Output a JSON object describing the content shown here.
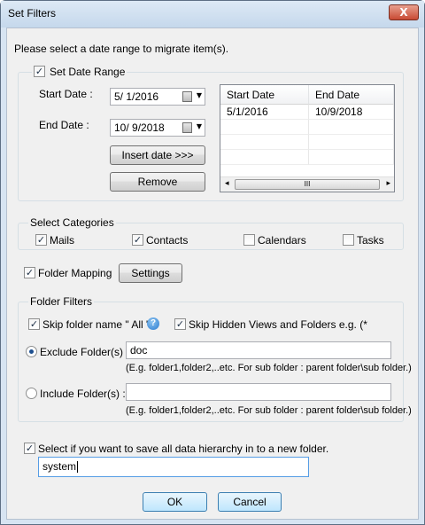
{
  "window": {
    "title": "Set Filters",
    "close_glyph": "X"
  },
  "intro": "Please select a date range to migrate item(s).",
  "date_range": {
    "legend": "Set Date Range",
    "checked": true,
    "start_label": "Start Date :",
    "start_value": "5/  1/2016",
    "end_label": "End Date :",
    "end_value": "10/  9/2018",
    "insert_button": "Insert date >>>",
    "remove_button": "Remove",
    "grid": {
      "columns": [
        "Start Date",
        "End Date"
      ],
      "rows": [
        [
          "5/1/2016",
          "10/9/2018"
        ]
      ],
      "scroll_left": "◂",
      "scroll_thumb": "III",
      "scroll_right": "▸"
    }
  },
  "categories": {
    "legend": "Select Categories",
    "items": [
      {
        "label": "Mails",
        "checked": true
      },
      {
        "label": "Contacts",
        "checked": true
      },
      {
        "label": "Calendars",
        "checked": false
      },
      {
        "label": "Tasks",
        "checked": false
      }
    ]
  },
  "folder_mapping": {
    "label": "Folder Mapping",
    "checked": true,
    "settings_button": "Settings"
  },
  "folder_filters": {
    "legend": "Folder Filters",
    "skip_all_label": "Skip folder name \" All \"",
    "skip_all_checked": true,
    "help_glyph": "?",
    "skip_hidden_label": "Skip Hidden Views and Folders e.g. (*",
    "skip_hidden_checked": true,
    "exclude_label": "Exclude Folder(s) :",
    "exclude_selected": true,
    "exclude_value": "doc",
    "exclude_hint": "(E.g. folder1,folder2,..etc. For sub folder : parent folder\\sub folder.)",
    "include_label": "Include Folder(s) :",
    "include_selected": false,
    "include_value": "",
    "include_hint": "(E.g. folder1,folder2,..etc. For sub folder : parent folder\\sub folder.)"
  },
  "hierarchy": {
    "label": "Select if you want to save all data hierarchy in to a new folder.",
    "checked": true,
    "value": "system"
  },
  "buttons": {
    "ok": "OK",
    "cancel": "Cancel"
  },
  "check_glyph": "✓",
  "calendar_icon": "calendar-icon",
  "dropdown_glyph": "▼",
  "colors": {
    "title_bg": "#c5d8ec",
    "client_bg": "#f0f0f0",
    "close_button": "#c84a33",
    "radio_dot": "#1d4f8f"
  }
}
